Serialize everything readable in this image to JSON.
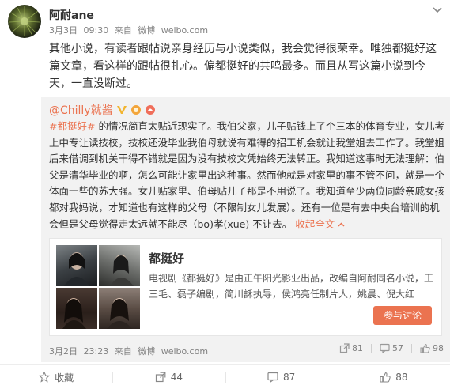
{
  "post": {
    "username": "阿耐ane",
    "date": "3月3日",
    "time": "09:30",
    "source_prefix": "来自",
    "source": "微博",
    "site": "weibo.com",
    "body": "其他小说，有读者跟帖说亲身经历与小说类似，我会觉得很荣幸。唯独都挺好这篇文章，看这样的跟帖很扎心。偏都挺好的共鸣最多。而且从写这篇小说到今天，一直没断过。"
  },
  "repost": {
    "author": "@Chilly就酱",
    "hashtag": "#都挺好#",
    "text": "的情况简直太贴近现实了。我伯父家，儿子贴钱上了个三本的体育专业，女儿考上中专让读技校，技校还没毕业我伯母就说有难得的招工机会就让我堂姐去工作了。我堂姐后来借调到机关干得不错就是因为没有技校文凭始终无法转正。我知道这事时无法理解：伯父是清华毕业的啊，怎么可能让家里出这种事。然而他就是对家里的事不管不问，就是一个体面一些的苏大强。女儿贴家里、伯母贴儿子那是不用说了。我知道至少两位同龄亲戚女孩都对我妈说，才知道也有这样的父母（不限制女儿发展）。还有一位是有去中央台培训的机会但是父母觉得走太远就不能尽（bo)孝(xue) 不让去。",
    "expand": "收起全文",
    "card": {
      "title": "都挺好",
      "description": "电视剧《都挺好》是由正午阳光影业出品，改编自阿耐同名小说，王三毛、磊子编剧，简川訸执导，侯鸿亮任制片人，姚晨、倪大红",
      "button": "参与讨论"
    },
    "date": "3月2日",
    "time": "23:23",
    "source_prefix": "来自",
    "source": "微博",
    "site": "weibo.com",
    "shares": "81",
    "comments": "57",
    "likes": "98"
  },
  "footer": {
    "favorite": "收藏",
    "share_count": "44",
    "comment_count": "87",
    "like_count": "88"
  },
  "colors": {
    "accent": "#eb7350",
    "muted": "#808080",
    "repost_bg": "#f2f2f2",
    "badge_gold": "#f2b530"
  },
  "icons": {
    "header_menu": "chevron-down-icon",
    "share": "share-icon",
    "comment": "comment-icon",
    "like": "thumbs-up-icon",
    "favorite": "star-icon"
  }
}
